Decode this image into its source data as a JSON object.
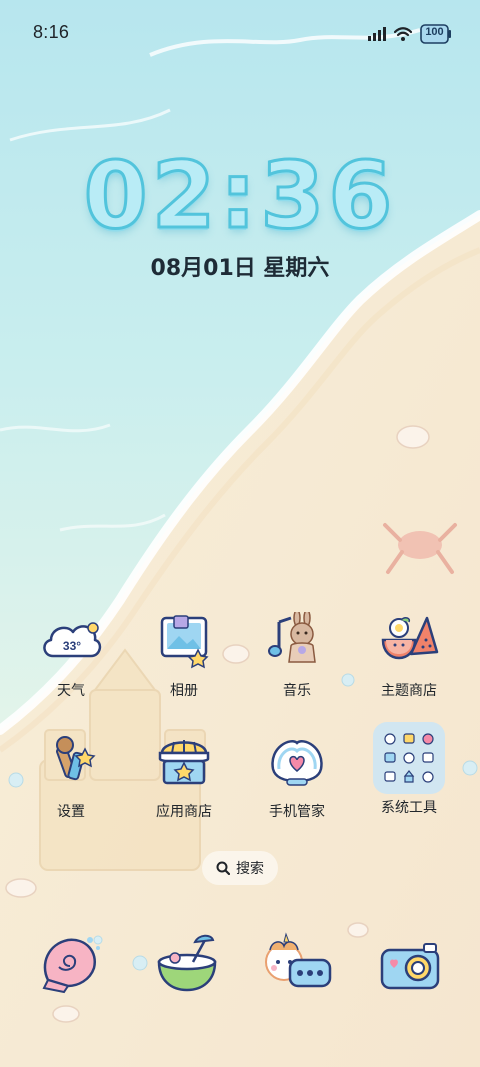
{
  "status_bar": {
    "time": "8:16",
    "battery_level": "100",
    "icons": [
      "signal-icon",
      "wifi-icon",
      "battery-icon"
    ]
  },
  "clock": {
    "time": "02:36",
    "date": "08月01日 星期六"
  },
  "apps": [
    {
      "label": "天气",
      "icon": "weather-cloud-icon",
      "badge": "33°"
    },
    {
      "label": "相册",
      "icon": "gallery-photo-icon"
    },
    {
      "label": "音乐",
      "icon": "music-bunny-icon"
    },
    {
      "label": "主题商店",
      "icon": "theme-store-fruit-icon"
    },
    {
      "label": "设置",
      "icon": "settings-keys-icon"
    },
    {
      "label": "应用商店",
      "icon": "app-store-shop-icon"
    },
    {
      "label": "手机管家",
      "icon": "phone-manager-heart-icon"
    },
    {
      "label": "系统工具",
      "icon": "system-tools-folder-icon"
    }
  ],
  "search": {
    "label": "搜索",
    "icon": "search-icon"
  },
  "dock": [
    {
      "icon": "phone-shell-icon"
    },
    {
      "icon": "messages-coconut-icon"
    },
    {
      "icon": "browser-hamster-icon"
    },
    {
      "icon": "camera-icon"
    }
  ],
  "colors": {
    "clock_fill": "#b9ecf6",
    "clock_outline": "#52c4dc",
    "icon_outline": "#2b3f7a",
    "sea": "#bfe9ef",
    "sand": "#f7ecd6"
  }
}
